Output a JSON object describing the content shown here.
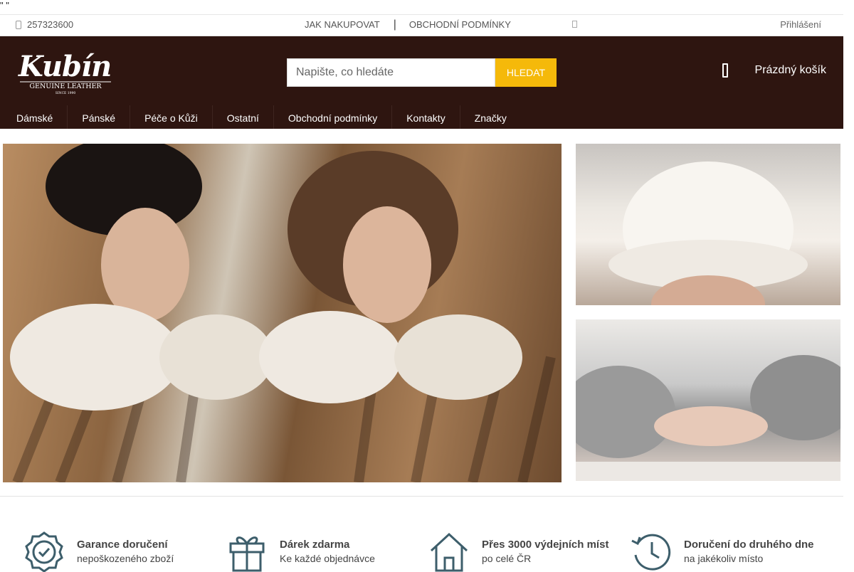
{
  "stray_text": "\" \"",
  "topbar": {
    "phone": "257323600",
    "links": [
      {
        "label": "Jak nakupovat"
      },
      {
        "label": "Obchodní podmínky"
      }
    ],
    "login": "Přihlášení"
  },
  "header": {
    "logo": {
      "brand": "Kubín",
      "tagline": "GENUINE LEATHER",
      "since": "SINCE 1990"
    },
    "search": {
      "placeholder": "Napište, co hledáte",
      "button": "Hledat"
    },
    "cart": {
      "label": "Prázdný košík"
    }
  },
  "nav": [
    {
      "label": "Dámské"
    },
    {
      "label": "Pánské"
    },
    {
      "label": "Péče o Kůži"
    },
    {
      "label": "Ostatní"
    },
    {
      "label": "Obchodní podmínky"
    },
    {
      "label": "Kontakty"
    },
    {
      "label": "Značky"
    }
  ],
  "features": [
    {
      "title": "Garance doručení",
      "subtitle": "nepoškozeného zboží",
      "icon": "badge-check-icon"
    },
    {
      "title": "Dárek zdarma",
      "subtitle": "Ke každé objednávce",
      "icon": "gift-icon"
    },
    {
      "title": "Přes 3000 výdejních míst",
      "subtitle": "po celé ČR",
      "icon": "home-icon"
    },
    {
      "title": "Doručení do druhého dne",
      "subtitle": "na jakékoliv místo",
      "icon": "clock-history-icon"
    }
  ],
  "colors": {
    "header_bg": "#2e1510",
    "accent": "#f5b90a",
    "icon": "#3d5e6b"
  }
}
